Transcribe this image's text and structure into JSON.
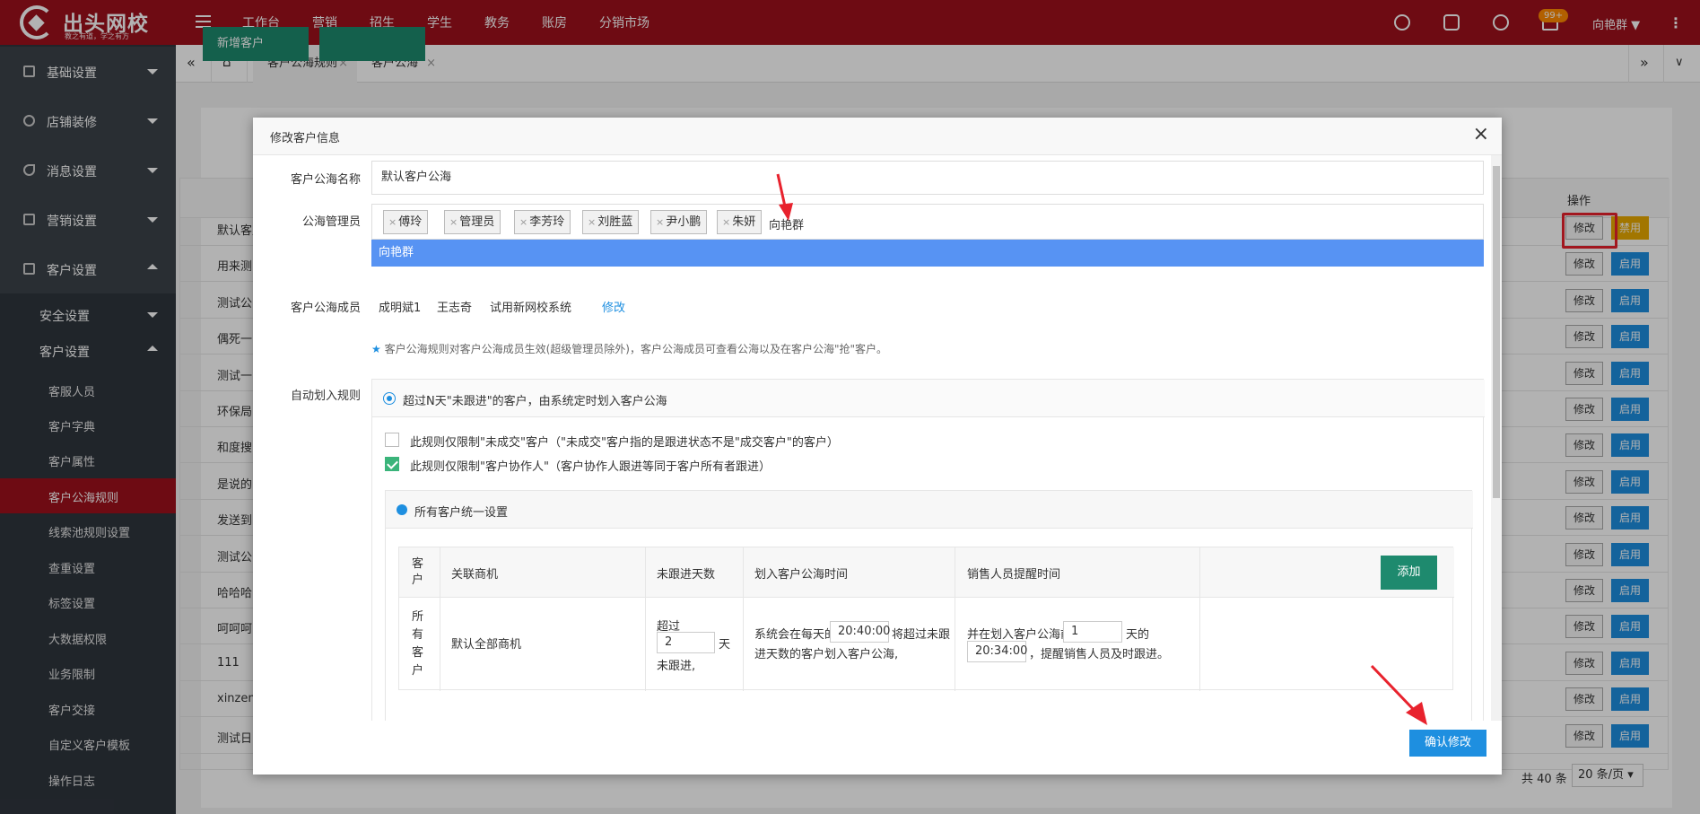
{
  "brand": {
    "title": "出头网校",
    "tagline": "教之有道，学之有方"
  },
  "topnav": [
    "工作台",
    "营销",
    "招生",
    "学生",
    "教务",
    "账房",
    "分销市场"
  ],
  "topnav_active": "招生",
  "notifications_badge": "99+",
  "user": "向艳群",
  "sidebar": {
    "items": [
      {
        "label": "基础设置"
      },
      {
        "label": "店铺装修"
      },
      {
        "label": "消息设置"
      },
      {
        "label": "营销设置"
      },
      {
        "label": "客户设置"
      }
    ],
    "sub_security": "安全设置",
    "sub_customer": "客户设置",
    "leaves": [
      "客服人员",
      "客户字典",
      "客户属性",
      "客户公海规则",
      "线索池规则设置",
      "查重设置",
      "标签设置",
      "大数据权限",
      "业务限制",
      "客户交接",
      "自定义客户模板",
      "操作日志"
    ],
    "active_leaf": "客户公海规则"
  },
  "tabs": [
    {
      "label": "客户公海规则"
    },
    {
      "label": "客户公海"
    }
  ],
  "background": {
    "new_button": "新增客户",
    "op_header": "操作",
    "rows": [
      "默认客户公海",
      "用来测",
      "测试公",
      "偶死一",
      "测试一",
      "环保局",
      "和度搜",
      "是说的",
      "发送到",
      "测试公",
      "哈哈哈",
      "呵呵呵",
      "111",
      "xinzen",
      "测试日"
    ],
    "edit_label": "修改",
    "enable_label": "启用",
    "disable_label": "禁用",
    "total": "共 40 条",
    "page_size": "20 条/页"
  },
  "modal": {
    "title": "修改客户信息",
    "name_label": "客户公海名称",
    "name_value": "默认客户公海",
    "managers_label": "公海管理员",
    "managers": [
      "傅玲",
      "管理员",
      "李芳玲",
      "刘胜蓝",
      "尹小鹏",
      "朱妍"
    ],
    "typing": "向艳群",
    "dropdown_option": "向艳群",
    "members_label": "客户公海成员",
    "members": [
      "成明斌1",
      "王志奇",
      "试用新网校系统"
    ],
    "members_edit": "修改",
    "hint": "客户公海规则对客户公海成员生效(超级管理员除外)，客户公海成员可查看公海以及在客户公海\"抢\"客户。",
    "rule_label": "自动划入规则",
    "rule_option": "超过N天\"未跟进\"的客户，由系统定时划入客户公海",
    "limit1": "此规则仅限制\"未成交\"客户（\"未成交\"客户指的是跟进状态不是\"成交客户\"的客户）",
    "limit1_checked": false,
    "limit2": "此规则仅限制\"客户协作人\"（客户协作人跟进等同于客户所有者跟进）",
    "limit2_checked": true,
    "uniform_label": "所有客户统一设置",
    "table": {
      "headers": [
        "客户",
        "关联商机",
        "未跟进天数",
        "划入客户公海时间",
        "销售人员提醒时间"
      ],
      "add_label": "添加",
      "row": {
        "customer": "所有客户",
        "opportunity": "默认全部商机",
        "days_pre": "超过",
        "days_value": "2",
        "days_unit": "天",
        "days_post": "未跟进,",
        "time_pre": "系统会在每天的",
        "time_value": "20:40:00",
        "time_post1": "将超过未跟",
        "time_post2": "进天数的客户划入客户公海,",
        "remind_pre": "并在划入客户公海前",
        "remind_days": "1",
        "remind_unit": "天的",
        "remind_time": "20:34:00",
        "remind_post": "，提醒销售人员及时跟进。"
      }
    },
    "confirm": "确认修改"
  },
  "colors": {
    "brand_red": "#9e111c",
    "primary_blue": "#1e8fe0",
    "green": "#1e8a6e",
    "annotation_red": "#e8222d"
  }
}
